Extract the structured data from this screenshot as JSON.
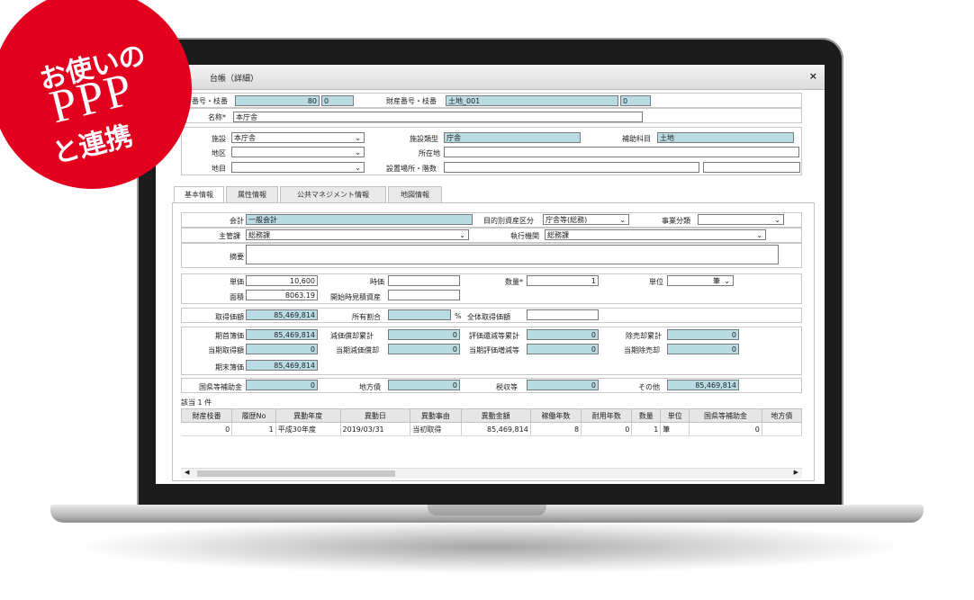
{
  "badge": {
    "line1": "お使いの",
    "line2": "PPP",
    "line3": "と連携"
  },
  "window": {
    "title": "台帳（詳細）",
    "close": "×"
  },
  "top": {
    "asset_no_label": "番号・枝番",
    "asset_no": "80",
    "asset_branch": "0",
    "zaisan_label": "財産番号・枝番",
    "zaisan_no": "土地_001",
    "zaisan_branch": "0",
    "name_label": "名称*",
    "name_value": "本庁舎",
    "shisetsu_label": "施設",
    "shisetsu_value": "本庁舎",
    "shisetsu_type_label": "施設類型",
    "shisetsu_type_value": "庁舎",
    "hojo_label": "補助科目",
    "hojo_value": "土地",
    "chiku_label": "地区",
    "chiku_value": "",
    "shozai_label": "所在地",
    "shozai_value": "",
    "chimoku_label": "地目",
    "chimoku_value": "",
    "secchi_label": "設置場所・階数",
    "secchi_value": "",
    "kaisu_value": ""
  },
  "tabs": [
    "基本情報",
    "属性情報",
    "公共マネジメント情報",
    "地図情報"
  ],
  "basic": {
    "kaikei_label": "会計",
    "kaikei_value": "一般会計",
    "mokuteki_label": "目的別資産区分",
    "mokuteki_value": "庁舎等(総務)",
    "jigyo_label": "事業分類",
    "jigyo_value": "",
    "shukan_label": "主管課",
    "shukan_value": "総務課",
    "shikko_label": "執行機関",
    "shikko_value": "総務課",
    "tekiyo_label": "摘要",
    "tekiyo_value": "",
    "tanka_label": "単価",
    "tanka_value": "10,600",
    "jika_label": "時価",
    "jika_value": "",
    "suryo_label": "数量*",
    "suryo_value": "1",
    "tani_label": "単位",
    "tani_value": "筆",
    "menseki_label": "面積",
    "menseki_value": "8063.19",
    "kaishi_label": "開始時見積資産",
    "kaishi_value": "",
    "shutoku_label": "取得価額",
    "shutoku_value": "85,469,814",
    "shoyu_label": "所有割合",
    "shoyu_value": "",
    "pct": "%",
    "zentai_label": "全体取得価額",
    "zentai_value": "",
    "kishu_label": "期首簿価",
    "kishu_value": "85,469,814",
    "genka_label": "減価償却累計",
    "genka_value": "0",
    "hyoka_label": "評価還減等累計",
    "hyoka_value": "0",
    "jokyaku_label": "除売却累計",
    "jokyaku_value": "0",
    "tokishutoku_label": "当期取得額",
    "tokishutoku_value": "0",
    "tokigenka_label": "当期減価償却",
    "tokigenka_value": "0",
    "tokihyoka_label": "当期評価増減等",
    "tokihyoka_value": "0",
    "tokijokyaku_label": "当期除売却",
    "tokijokyaku_value": "0",
    "kimatsu_label": "期末簿価",
    "kimatsu_value": "85,469,814",
    "kokko_label": "国県等補助金",
    "kokko_value": "0",
    "chihosai_label": "地方債",
    "chihosai_value": "0",
    "zeishu_label": "税収等",
    "zeishu_value": "0",
    "sonota_label": "その他",
    "sonota_value": "85,469,814"
  },
  "history": {
    "count_label": "該当 1 件",
    "columns": [
      "財産枝番",
      "履歴No",
      "異動年度",
      "異動日",
      "異動事由",
      "異動金額",
      "稼働年数",
      "耐用年数",
      "数量",
      "単位",
      "国県等補助金",
      "地方債"
    ],
    "rows": [
      [
        "0",
        "1",
        "平成30年度",
        "2019/03/31",
        "当初取得",
        "85,469,814",
        "8",
        "0",
        "1",
        "筆",
        "0",
        ""
      ]
    ]
  }
}
